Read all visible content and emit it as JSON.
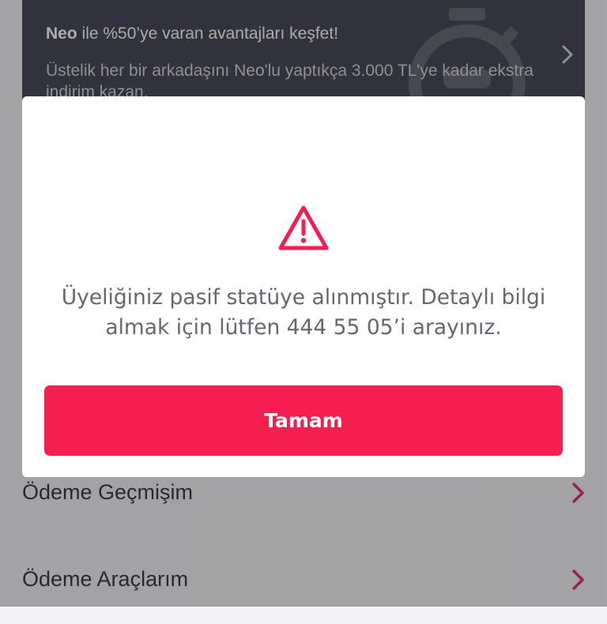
{
  "promo": {
    "brand": "Neo",
    "title_rest": " ile %50’ye varan avantajları keşfet!",
    "body": "Üstelik her bir arkadaşını Neo'lu yaptıkça 3.000 TL'ye kadar ekstra indirim kazan.",
    "chevron_icon": "chevron-right-icon",
    "watermark_icon": "stopwatch-icon"
  },
  "menu": {
    "items": [
      {
        "label": "Ödeme Geçmişim",
        "icon": "chevron-right-icon"
      },
      {
        "label": "Ödeme Araçlarım",
        "icon": "chevron-right-icon"
      }
    ]
  },
  "dialog": {
    "icon": "warning-triangle-icon",
    "message": "Üyeliğiniz pasif statüye alınmıştır. Detaylı bilgi almak için lütfen 444 55 05’i arayınız.",
    "button_label": "Tamam"
  },
  "colors": {
    "accent": "#f61d4f",
    "promo_background": "#4a4b5c",
    "menu_chevron": "#e0356a",
    "message_text": "#67686f"
  }
}
